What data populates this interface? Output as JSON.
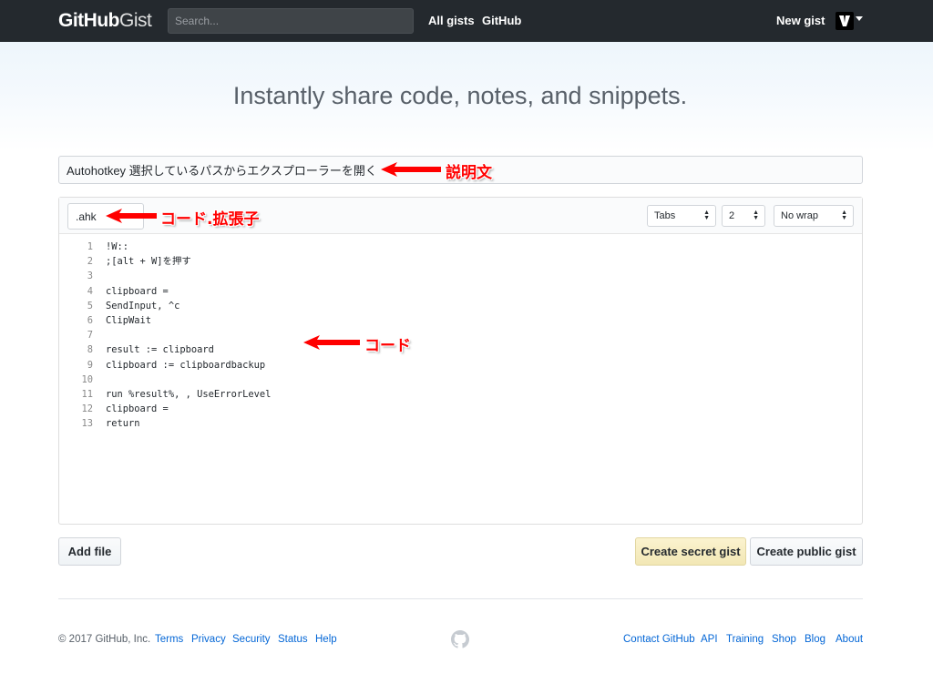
{
  "header": {
    "logo_main": "GitHub",
    "logo_sub": "Gist",
    "search_placeholder": "Search...",
    "nav": [
      "All gists",
      "GitHub"
    ],
    "new_gist": "New gist"
  },
  "hero": {
    "title": "Instantly share code, notes, and snippets."
  },
  "form": {
    "description_value": "Autohotkey 選択しているパスからエクスプローラーを開く",
    "filename_value": ".ahk",
    "indent_mode": "Tabs",
    "indent_size": "2",
    "wrap_mode": "No wrap",
    "code_lines": [
      {
        "n": "1",
        "t": "!W::"
      },
      {
        "n": "2",
        "t": ";[alt + W]を押す"
      },
      {
        "n": "3",
        "t": ""
      },
      {
        "n": "4",
        "t": "clipboard ="
      },
      {
        "n": "5",
        "t": "SendInput, ^c"
      },
      {
        "n": "6",
        "t": "ClipWait"
      },
      {
        "n": "7",
        "t": ""
      },
      {
        "n": "8",
        "t": "result := clipboard"
      },
      {
        "n": "9",
        "t": "clipboard := clipboardbackup"
      },
      {
        "n": "10",
        "t": ""
      },
      {
        "n": "11",
        "t": "run %result%, , UseErrorLevel"
      },
      {
        "n": "12",
        "t": "clipboard ="
      },
      {
        "n": "13",
        "t": "return"
      }
    ],
    "add_file": "Add file",
    "create_secret": "Create secret gist",
    "create_public": "Create public gist"
  },
  "annotations": {
    "description_label": "説明文",
    "filename_label": "コード.拡張子",
    "code_label": "コード"
  },
  "footer": {
    "copyright": "© 2017 GitHub, Inc.",
    "left_links": [
      "Terms",
      "Privacy",
      "Security",
      "Status",
      "Help"
    ],
    "right_links": [
      "Contact GitHub",
      "API",
      "Training",
      "Shop",
      "Blog",
      "About"
    ]
  },
  "colors": {
    "header_bg": "#24292e",
    "link": "#0366d6",
    "annotation": "#ff0000",
    "secret_btn": "#f2e7b5"
  }
}
